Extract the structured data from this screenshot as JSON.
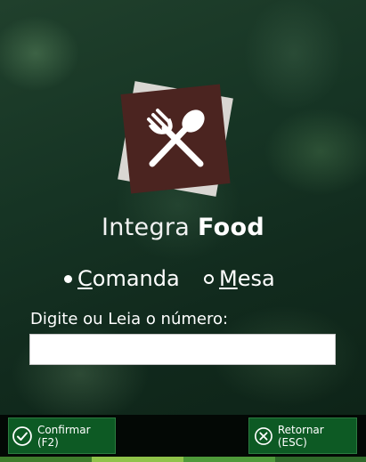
{
  "brand": {
    "light": "Integra",
    "bold": "Food"
  },
  "mode": {
    "options": [
      {
        "id": "comanda",
        "prefix": "C",
        "rest": "omanda",
        "selected": true
      },
      {
        "id": "mesa",
        "prefix": "M",
        "rest": "esa",
        "selected": false
      }
    ]
  },
  "form": {
    "prompt": "Digite ou Leia o número:",
    "value": ""
  },
  "footer": {
    "confirm_label": "Confirmar (F2)",
    "return_label": "Retornar (ESC)"
  },
  "colors": {
    "logo_front": "#4b2420",
    "logo_back": "#d9d6d2",
    "button_bg": "#0d5a24",
    "footer_bg": "#030805"
  }
}
